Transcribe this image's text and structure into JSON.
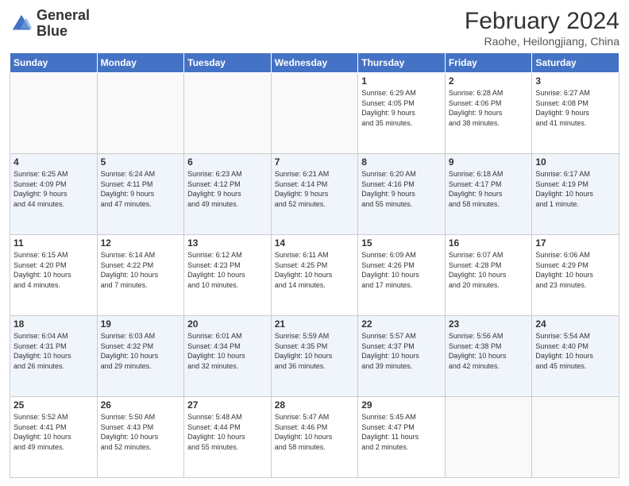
{
  "header": {
    "logo_line1": "General",
    "logo_line2": "Blue",
    "month_title": "February 2024",
    "location": "Raohe, Heilongjiang, China"
  },
  "days_of_week": [
    "Sunday",
    "Monday",
    "Tuesday",
    "Wednesday",
    "Thursday",
    "Friday",
    "Saturday"
  ],
  "weeks": [
    [
      {
        "day": "",
        "info": ""
      },
      {
        "day": "",
        "info": ""
      },
      {
        "day": "",
        "info": ""
      },
      {
        "day": "",
        "info": ""
      },
      {
        "day": "1",
        "info": "Sunrise: 6:29 AM\nSunset: 4:05 PM\nDaylight: 9 hours\nand 35 minutes."
      },
      {
        "day": "2",
        "info": "Sunrise: 6:28 AM\nSunset: 4:06 PM\nDaylight: 9 hours\nand 38 minutes."
      },
      {
        "day": "3",
        "info": "Sunrise: 6:27 AM\nSunset: 4:08 PM\nDaylight: 9 hours\nand 41 minutes."
      }
    ],
    [
      {
        "day": "4",
        "info": "Sunrise: 6:25 AM\nSunset: 4:09 PM\nDaylight: 9 hours\nand 44 minutes."
      },
      {
        "day": "5",
        "info": "Sunrise: 6:24 AM\nSunset: 4:11 PM\nDaylight: 9 hours\nand 47 minutes."
      },
      {
        "day": "6",
        "info": "Sunrise: 6:23 AM\nSunset: 4:12 PM\nDaylight: 9 hours\nand 49 minutes."
      },
      {
        "day": "7",
        "info": "Sunrise: 6:21 AM\nSunset: 4:14 PM\nDaylight: 9 hours\nand 52 minutes."
      },
      {
        "day": "8",
        "info": "Sunrise: 6:20 AM\nSunset: 4:16 PM\nDaylight: 9 hours\nand 55 minutes."
      },
      {
        "day": "9",
        "info": "Sunrise: 6:18 AM\nSunset: 4:17 PM\nDaylight: 9 hours\nand 58 minutes."
      },
      {
        "day": "10",
        "info": "Sunrise: 6:17 AM\nSunset: 4:19 PM\nDaylight: 10 hours\nand 1 minute."
      }
    ],
    [
      {
        "day": "11",
        "info": "Sunrise: 6:15 AM\nSunset: 4:20 PM\nDaylight: 10 hours\nand 4 minutes."
      },
      {
        "day": "12",
        "info": "Sunrise: 6:14 AM\nSunset: 4:22 PM\nDaylight: 10 hours\nand 7 minutes."
      },
      {
        "day": "13",
        "info": "Sunrise: 6:12 AM\nSunset: 4:23 PM\nDaylight: 10 hours\nand 10 minutes."
      },
      {
        "day": "14",
        "info": "Sunrise: 6:11 AM\nSunset: 4:25 PM\nDaylight: 10 hours\nand 14 minutes."
      },
      {
        "day": "15",
        "info": "Sunrise: 6:09 AM\nSunset: 4:26 PM\nDaylight: 10 hours\nand 17 minutes."
      },
      {
        "day": "16",
        "info": "Sunrise: 6:07 AM\nSunset: 4:28 PM\nDaylight: 10 hours\nand 20 minutes."
      },
      {
        "day": "17",
        "info": "Sunrise: 6:06 AM\nSunset: 4:29 PM\nDaylight: 10 hours\nand 23 minutes."
      }
    ],
    [
      {
        "day": "18",
        "info": "Sunrise: 6:04 AM\nSunset: 4:31 PM\nDaylight: 10 hours\nand 26 minutes."
      },
      {
        "day": "19",
        "info": "Sunrise: 6:03 AM\nSunset: 4:32 PM\nDaylight: 10 hours\nand 29 minutes."
      },
      {
        "day": "20",
        "info": "Sunrise: 6:01 AM\nSunset: 4:34 PM\nDaylight: 10 hours\nand 32 minutes."
      },
      {
        "day": "21",
        "info": "Sunrise: 5:59 AM\nSunset: 4:35 PM\nDaylight: 10 hours\nand 36 minutes."
      },
      {
        "day": "22",
        "info": "Sunrise: 5:57 AM\nSunset: 4:37 PM\nDaylight: 10 hours\nand 39 minutes."
      },
      {
        "day": "23",
        "info": "Sunrise: 5:56 AM\nSunset: 4:38 PM\nDaylight: 10 hours\nand 42 minutes."
      },
      {
        "day": "24",
        "info": "Sunrise: 5:54 AM\nSunset: 4:40 PM\nDaylight: 10 hours\nand 45 minutes."
      }
    ],
    [
      {
        "day": "25",
        "info": "Sunrise: 5:52 AM\nSunset: 4:41 PM\nDaylight: 10 hours\nand 49 minutes."
      },
      {
        "day": "26",
        "info": "Sunrise: 5:50 AM\nSunset: 4:43 PM\nDaylight: 10 hours\nand 52 minutes."
      },
      {
        "day": "27",
        "info": "Sunrise: 5:48 AM\nSunset: 4:44 PM\nDaylight: 10 hours\nand 55 minutes."
      },
      {
        "day": "28",
        "info": "Sunrise: 5:47 AM\nSunset: 4:46 PM\nDaylight: 10 hours\nand 58 minutes."
      },
      {
        "day": "29",
        "info": "Sunrise: 5:45 AM\nSunset: 4:47 PM\nDaylight: 11 hours\nand 2 minutes."
      },
      {
        "day": "",
        "info": ""
      },
      {
        "day": "",
        "info": ""
      }
    ]
  ]
}
